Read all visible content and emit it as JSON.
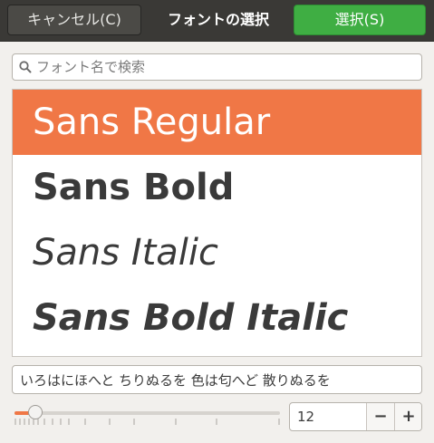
{
  "header": {
    "cancel_label": "キャンセル(C)",
    "title": "フォントの選択",
    "select_label": "選択(S)"
  },
  "search": {
    "placeholder": "フォント名で検索",
    "value": "",
    "icon": "search-icon"
  },
  "font_list": {
    "items": [
      {
        "label": "Sans Regular",
        "selected": true
      },
      {
        "label": "Sans Bold",
        "selected": false
      },
      {
        "label": "Sans Italic",
        "selected": false
      },
      {
        "label": "Sans Bold Italic",
        "selected": false
      }
    ]
  },
  "preview": {
    "value": "いろはにほへと ちりぬるを 色は匂へど 散りぬるを"
  },
  "size": {
    "value": "12",
    "minus_label": "−",
    "plus_label": "+",
    "slider_fraction": 0.08
  },
  "colors": {
    "accent": "#f07746",
    "confirm": "#3fae43",
    "header_bg": "#3a3936"
  }
}
